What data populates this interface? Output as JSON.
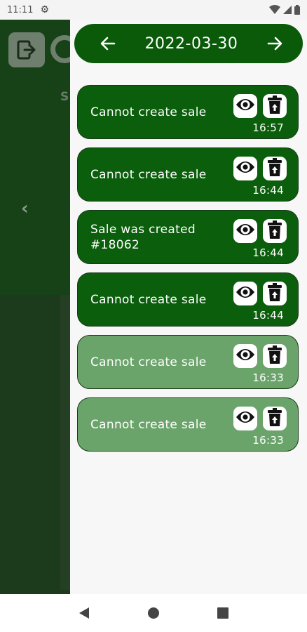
{
  "status_bar": {
    "time": "11:11"
  },
  "background_app": {
    "back_symbol": "‹",
    "letter_s": "S"
  },
  "drawer": {
    "date": "2022-03-30",
    "entries": [
      {
        "text": "Cannot create sale",
        "time": "16:57",
        "style": "dark"
      },
      {
        "text": "Cannot create sale",
        "time": "16:44",
        "style": "dark"
      },
      {
        "text": "Sale was created #18062",
        "time": "16:44",
        "style": "dark"
      },
      {
        "text": "Cannot create sale",
        "time": "16:44",
        "style": "dark"
      },
      {
        "text": "Cannot create sale",
        "time": "16:33",
        "style": "light"
      },
      {
        "text": "Cannot create sale",
        "time": "16:33",
        "style": "light"
      }
    ]
  },
  "colors": {
    "dark_card": "#0b5e0b",
    "light_card": "#6ba46b",
    "header": "#0a5a0a"
  },
  "icons": [
    "settings-icon",
    "wifi-icon",
    "signal-icon",
    "battery-icon",
    "logout-icon",
    "arrow-left-icon",
    "arrow-right-icon",
    "eye-icon",
    "delete-icon",
    "nav-back-icon",
    "nav-home-icon",
    "nav-recents-icon"
  ]
}
